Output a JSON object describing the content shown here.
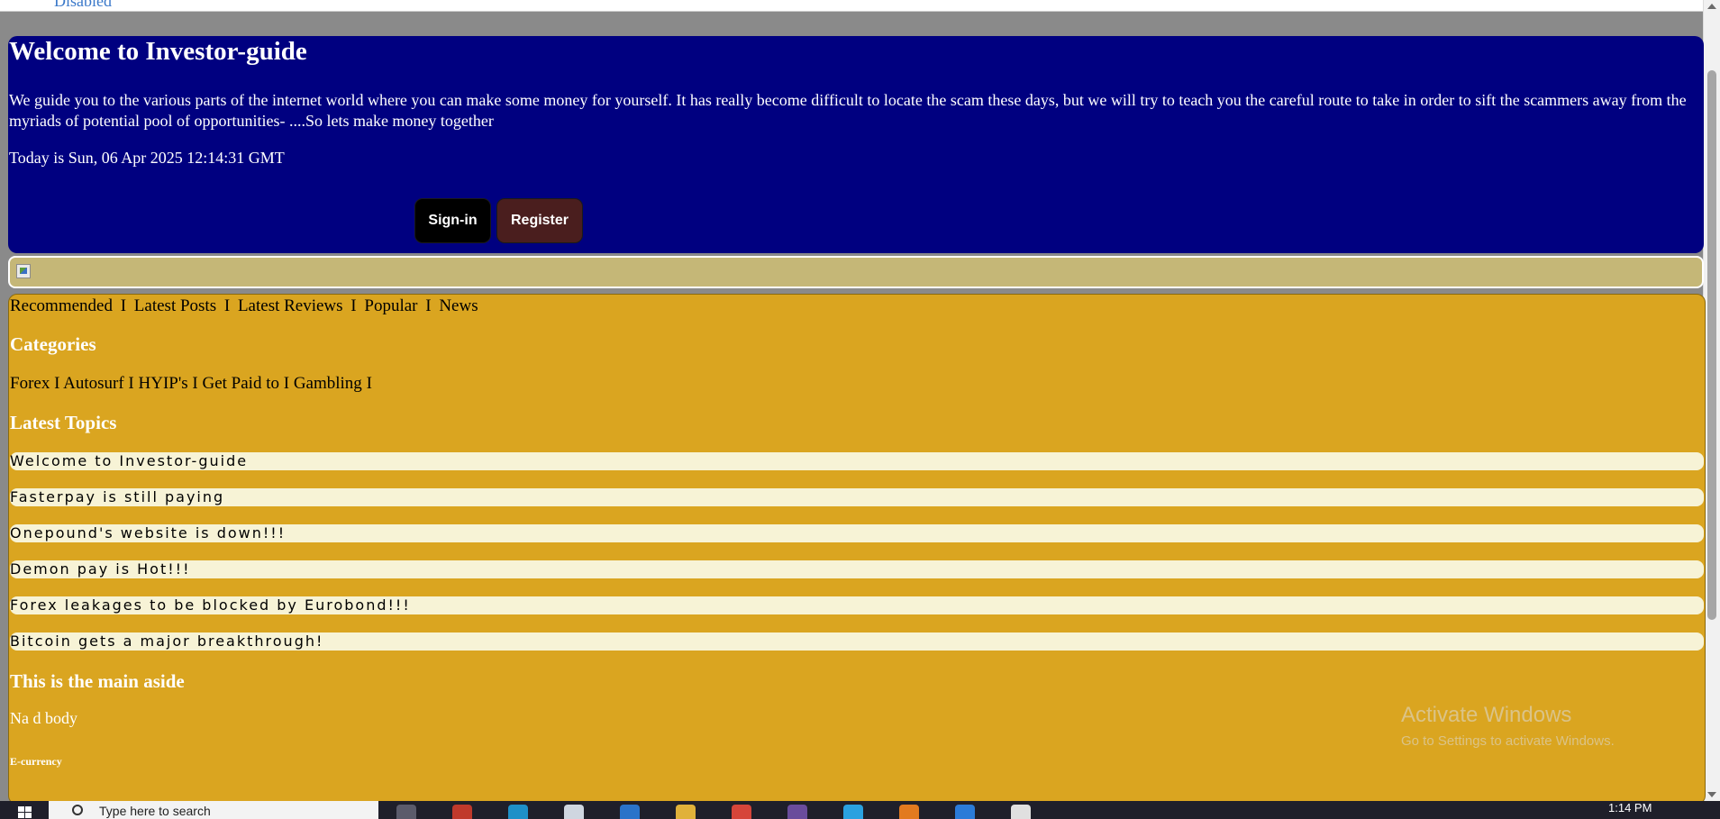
{
  "top_strip": {
    "text": "Disabled"
  },
  "header": {
    "title": "Welcome to Investor-guide",
    "intro": "We guide you to the various parts of the internet world where you can make some money for yourself. It has really become difficult to locate the scam these days, but we will try to teach you the careful route to take in order to sift the scammers away from the myriads of potential pool of opportunities- ....So lets make money together",
    "date": "Today is Sun, 06 Apr 2025 12:14:31 GMT",
    "signin_label": "Sign-in",
    "register_label": "Register"
  },
  "nav": {
    "items": [
      "Recommended",
      "Latest Posts",
      "Latest Reviews",
      "Popular",
      "News"
    ],
    "separator": "I"
  },
  "categories": {
    "heading": "Categories",
    "items": [
      "Forex",
      "Autosurf",
      "HYIP's",
      "Get Paid to",
      "Gambling"
    ],
    "separator": "I"
  },
  "latest_topics": {
    "heading": "Latest Topics",
    "items": [
      "Welcome to Investor-guide",
      "Fasterpay is still paying",
      "Onepound's website is down!!!",
      "Demon pay is Hot!!!",
      "Forex leakages to be blocked by Eurobond!!!",
      "Bitcoin gets a major breakthrough!"
    ]
  },
  "aside": {
    "heading": "This is the main aside",
    "body": "Na d body",
    "subheading": "E-currency"
  },
  "watermark": {
    "line1": "Activate Windows",
    "line2": "Go to Settings to activate Windows."
  },
  "taskbar": {
    "search_placeholder": "Type here to search",
    "time": "1:14 PM"
  },
  "colors": {
    "header_bg": "#000080",
    "banner_bg": "#c5b777",
    "main_bg": "#daa520",
    "topic_bg": "#f7f3d6",
    "signin_bg": "#000000",
    "register_bg": "#4a1e1e"
  }
}
